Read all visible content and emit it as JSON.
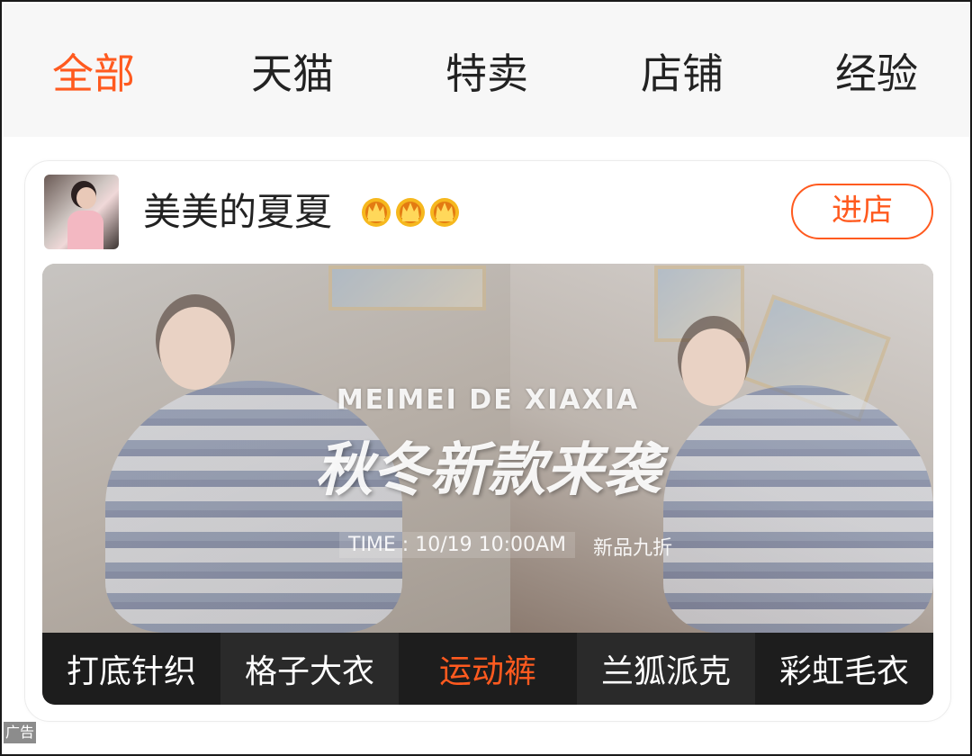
{
  "tabs": [
    {
      "label": "全部",
      "active": true
    },
    {
      "label": "天猫",
      "active": false
    },
    {
      "label": "特卖",
      "active": false
    },
    {
      "label": "店铺",
      "active": false
    },
    {
      "label": "经验",
      "active": false
    }
  ],
  "shop": {
    "name": "美美的夏夏",
    "crown_count": 3,
    "crown_icon": "crown-icon",
    "enter_label": "进店"
  },
  "banner": {
    "title_en": "MEIMEI DE XIAXIA",
    "title_cn": "秋冬新款来袭",
    "time_text": "TIME : 10/19 10:00AM",
    "promo_text": "新品九折",
    "categories": [
      {
        "label": "打底针织",
        "highlight": false
      },
      {
        "label": "格子大衣",
        "highlight": false
      },
      {
        "label": "运动裤",
        "highlight": true
      },
      {
        "label": "兰狐派克",
        "highlight": false
      },
      {
        "label": "彩虹毛衣",
        "highlight": false
      }
    ]
  },
  "ad_label": "广告",
  "colors": {
    "accent": "#ff5a1f",
    "tab_bar_bg": "#f7f7f7",
    "category_bar_bg": "#1d1d1d"
  }
}
